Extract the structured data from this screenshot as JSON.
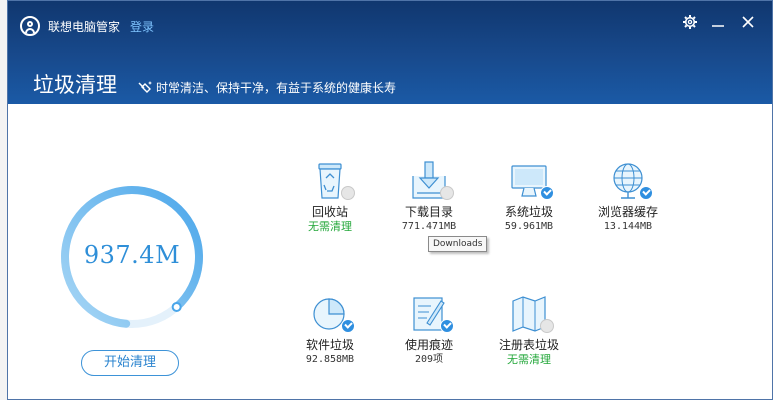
{
  "app": {
    "title": "联想电脑管家",
    "login": "登录"
  },
  "page": {
    "title": "垃圾清理",
    "slogan": "时常清洁、保持干净，有益于系统的健康长寿"
  },
  "summary": {
    "total": "937.4M",
    "progress": 0.87,
    "start_label": "开始清理"
  },
  "items": [
    {
      "label": "回收站",
      "value": "无需清理",
      "icon": "recycle-bin-icon",
      "status": "empty"
    },
    {
      "label": "下载目录",
      "value": "771.471MB",
      "icon": "download-folder-icon",
      "status": "empty"
    },
    {
      "label": "系统垃圾",
      "value": "59.961MB",
      "icon": "monitor-icon",
      "status": "check"
    },
    {
      "label": "浏览器缓存",
      "value": "13.144MB",
      "icon": "globe-icon",
      "status": "check"
    },
    {
      "label": "软件垃圾",
      "value": "92.858MB",
      "icon": "pie-chart-icon",
      "status": "check"
    },
    {
      "label": "使用痕迹",
      "value": "209项",
      "icon": "pen-document-icon",
      "status": "check"
    },
    {
      "label": "注册表垃圾",
      "value": "无需清理",
      "icon": "map-book-icon",
      "status": "empty"
    }
  ],
  "tooltip": "Downloads",
  "colors": {
    "header": "#184a8d",
    "accent": "#2f8fd8",
    "ok": "#23a73a"
  }
}
